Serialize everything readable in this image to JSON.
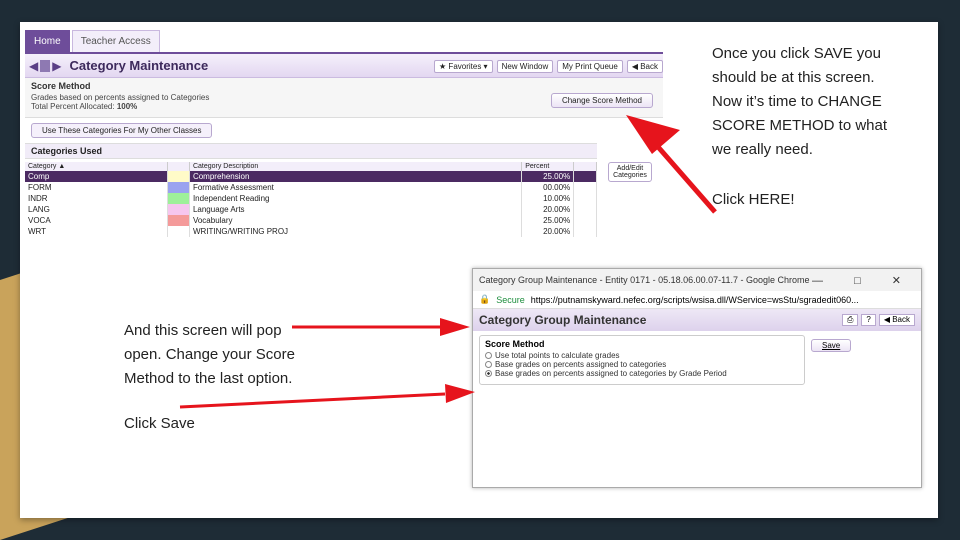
{
  "colors": {
    "accent": "#6e4d9a",
    "arrow": "#e6141c",
    "selected_row": "#4b2a62"
  },
  "screenshot": {
    "tabs": [
      "Home",
      "Teacher Access"
    ],
    "title": "Category Maintenance",
    "top_buttons": [
      "★ Favorites ▾",
      "New Window",
      "My Print Queue",
      "◀ Back"
    ],
    "score_method": {
      "heading": "Score Method",
      "line1": "Grades based on percents assigned to Categories",
      "line2_label": "Total Percent Allocated: ",
      "line2_value": "100%",
      "button": "Change Score Method"
    },
    "use_button": "Use These Categories For My Other Classes",
    "categories_heading": "Categories Used",
    "add_edit": "Add/Edit Categories",
    "columns": [
      "Category ▲",
      "",
      "Category Description",
      "Percent"
    ],
    "rows": [
      {
        "code": "Comp",
        "color": "#fffbc8",
        "desc": "Comprehension",
        "pct": "25.00%"
      },
      {
        "code": "FORM",
        "color": "#9aa3f0",
        "desc": "Formative Assessment",
        "pct": "00.00%"
      },
      {
        "code": "INDR",
        "color": "#9ef09a",
        "desc": "Independent Reading",
        "pct": "10.00%"
      },
      {
        "code": "LANG",
        "color": "#f6c6ef",
        "desc": "Language Arts",
        "pct": "20.00%"
      },
      {
        "code": "VOCA",
        "color": "#f49a9a",
        "desc": "Vocabulary",
        "pct": "25.00%"
      },
      {
        "code": "WRT",
        "color": "#ffffff",
        "desc": "WRITING/WRITING PROJ",
        "pct": "20.00%"
      }
    ]
  },
  "popup": {
    "window_title": "Category Group Maintenance - Entity 0171 - 05.18.06.00.07-11.7 - Google Chrome",
    "window_controls": "— □ ✕",
    "secure": "Secure",
    "url": "https://putnamskyward.nefec.org/scripts/wsisa.dll/WService=wsStu/sgradedit060...",
    "title": "Category Group Maintenance",
    "help": "?",
    "back": "◀ Back",
    "score_heading": "Score Method",
    "options": [
      "Use total points to calculate grades",
      "Base grades on percents assigned to categories",
      "Base grades on percents assigned to categories by Grade Period"
    ],
    "save": "Save"
  },
  "notes": {
    "right": [
      "Once you click SAVE you",
      "should be at this screen.",
      "Now it’s time to CHANGE",
      "SCORE METHOD to what",
      "we really need."
    ],
    "click_here": "Click HERE!",
    "left": [
      "And this screen will pop",
      "open.  Change your Score",
      "Method to the last option."
    ],
    "click_save": "Click Save"
  }
}
